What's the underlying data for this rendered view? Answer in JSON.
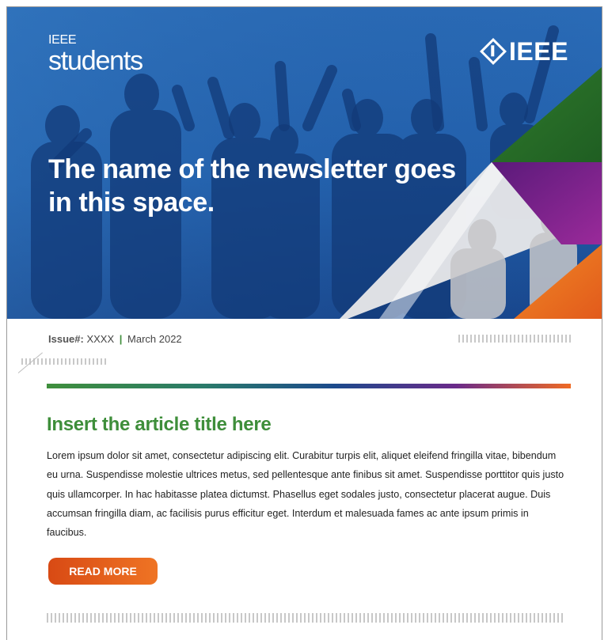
{
  "header": {
    "brand_small": "IEEE",
    "brand_large": "students",
    "logo_text": "IEEE",
    "headline": "The name of the newsletter goes in this space."
  },
  "issue": {
    "label": "Issue#:",
    "number": "XXXX",
    "separator": "|",
    "date": "March 2022"
  },
  "article": {
    "title": "Insert the article title here",
    "body": "Lorem ipsum dolor sit amet, consectetur adipiscing elit. Curabitur turpis elit, aliquet eleifend fringilla vitae, bibendum eu urna. Suspendisse molestie ultrices metus, sed pellentesque ante finibus sit amet. Suspendisse porttitor quis justo quis ullamcorper. In hac habitasse platea dictumst. Phasellus eget sodales justo, consectetur placerat augue. Duis accumsan fringilla diam, ac facilisis purus efficitur eget. Interdum et malesuada fames ac ante ipsum primis in faucibus.",
    "read_more_label": "READ MORE"
  },
  "colors": {
    "hero_blue": "#1e5aa8",
    "accent_green": "#3e8e3a",
    "accent_purple": "#7a1f8a",
    "accent_orange": "#ef6a24"
  }
}
